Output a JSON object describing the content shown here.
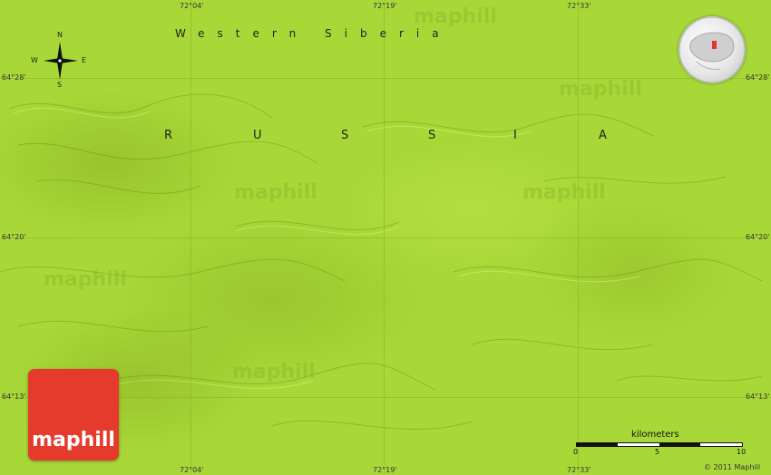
{
  "map": {
    "region_label": "Western Siberia",
    "country_label": [
      "R",
      "U",
      "S",
      "S",
      "I",
      "A"
    ],
    "coords": {
      "top_lon_1": "72°04'",
      "top_lon_2": "72°19'",
      "top_lon_3": "72°33'",
      "bottom_lon_1": "72°04'",
      "bottom_lon_2": "72°19'",
      "bottom_lon_3": "72°33'",
      "left_lat_1": "64°28'",
      "left_lat_2": "64°20'",
      "left_lat_3": "64°13'",
      "right_lat_1": "64°28'",
      "right_lat_2": "64°20'",
      "right_lat_3": "64°13'"
    },
    "watermark_text": "maphill",
    "terrain_color": "#a8d838"
  },
  "compass": {
    "n": "N",
    "s": "S",
    "e": "E",
    "w": "W"
  },
  "logo": {
    "text": "maphill",
    "color": "#e53b2c"
  },
  "scale": {
    "title": "kilometers",
    "start": "0",
    "mid": "5",
    "end": "10"
  },
  "copyright": "© 2011 Maphill"
}
